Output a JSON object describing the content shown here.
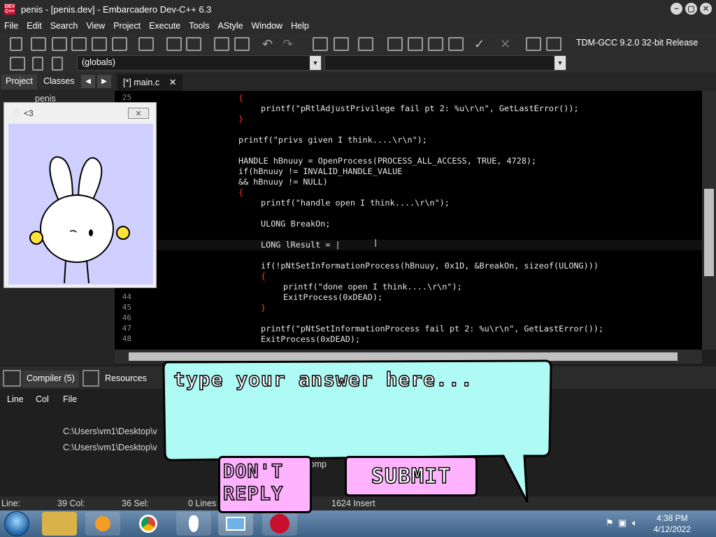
{
  "window": {
    "title": "penis - [penis.dev] - Embarcadero Dev-C++ 6.3",
    "app_icon_text": "DEV C++"
  },
  "menu": [
    "File",
    "Edit",
    "Search",
    "View",
    "Project",
    "Execute",
    "Tools",
    "AStyle",
    "Window",
    "Help"
  ],
  "toolbar": {
    "compiler_select": "TDM-GCC 9.2.0 32-bit Release",
    "scope_select": "(globals)"
  },
  "left_tabs": {
    "project": "Project",
    "classes": "Classes",
    "tree_item": "penis"
  },
  "editor_tab": {
    "label": "[*] main.c"
  },
  "code": {
    "line_numbers": [
      "25",
      "44",
      "45",
      "46",
      "47",
      "48"
    ],
    "lines": [
      "{",
      "printf(\"pRtlAdjustPrivilege fail pt 2: %u\\r\\n\", GetLastError());",
      "}",
      "printf(\"privs given I think....\\r\\n\");",
      "HANDLE hBnuuy = OpenProcess(PROCESS_ALL_ACCESS, TRUE, 4728);",
      "if(hBnuuy != INVALID_HANDLE_VALUE",
      "&& hBnuuy != NULL)",
      "{",
      "printf(\"handle open I think....\\r\\n\");",
      "ULONG BreakOn;",
      "LONG lResult = |",
      "if(!pNtSetInformationProcess(hBnuuy, 0x1D, &BreakOn, sizeof(ULONG)))",
      "{",
      "printf(\"done open I think....\\r\\n\");",
      "ExitProcess(0xDEAD);",
      "}",
      "printf(\"pNtSetInformationProcess fail pt 2: %u\\r\\n\", GetLastError());",
      "ExitProcess(0xDEAD);"
    ]
  },
  "bottom_tabs": {
    "compiler": "Compiler (5)",
    "resources": "Resources"
  },
  "log": {
    "columns": [
      "Line",
      "Col",
      "File"
    ],
    "rows": [
      {
        "file": "C:\\Users\\vm1\\Desktop\\v"
      },
      {
        "file": "C:\\Users\\vm1\\Desktop\\v"
      }
    ],
    "partial_text": "g comp"
  },
  "status": {
    "line": "Line:",
    "line_val": "39 Col:",
    "col_val": "36 Sel:",
    "sel_val": "0 Lines",
    "lines_val": "1624 Insert"
  },
  "popup": {
    "title": "<3"
  },
  "dialog": {
    "placeholder": "type your answer here...",
    "dont_reply": "DON'T REPLY",
    "submit": "SUBMIT"
  },
  "clock": {
    "time": "4:38 PM",
    "date": "4/12/2022"
  },
  "colors": {
    "bubble": "#aefaf5",
    "button_pink": "#ffb3ff",
    "popup_bg": "#cfd0ff"
  }
}
